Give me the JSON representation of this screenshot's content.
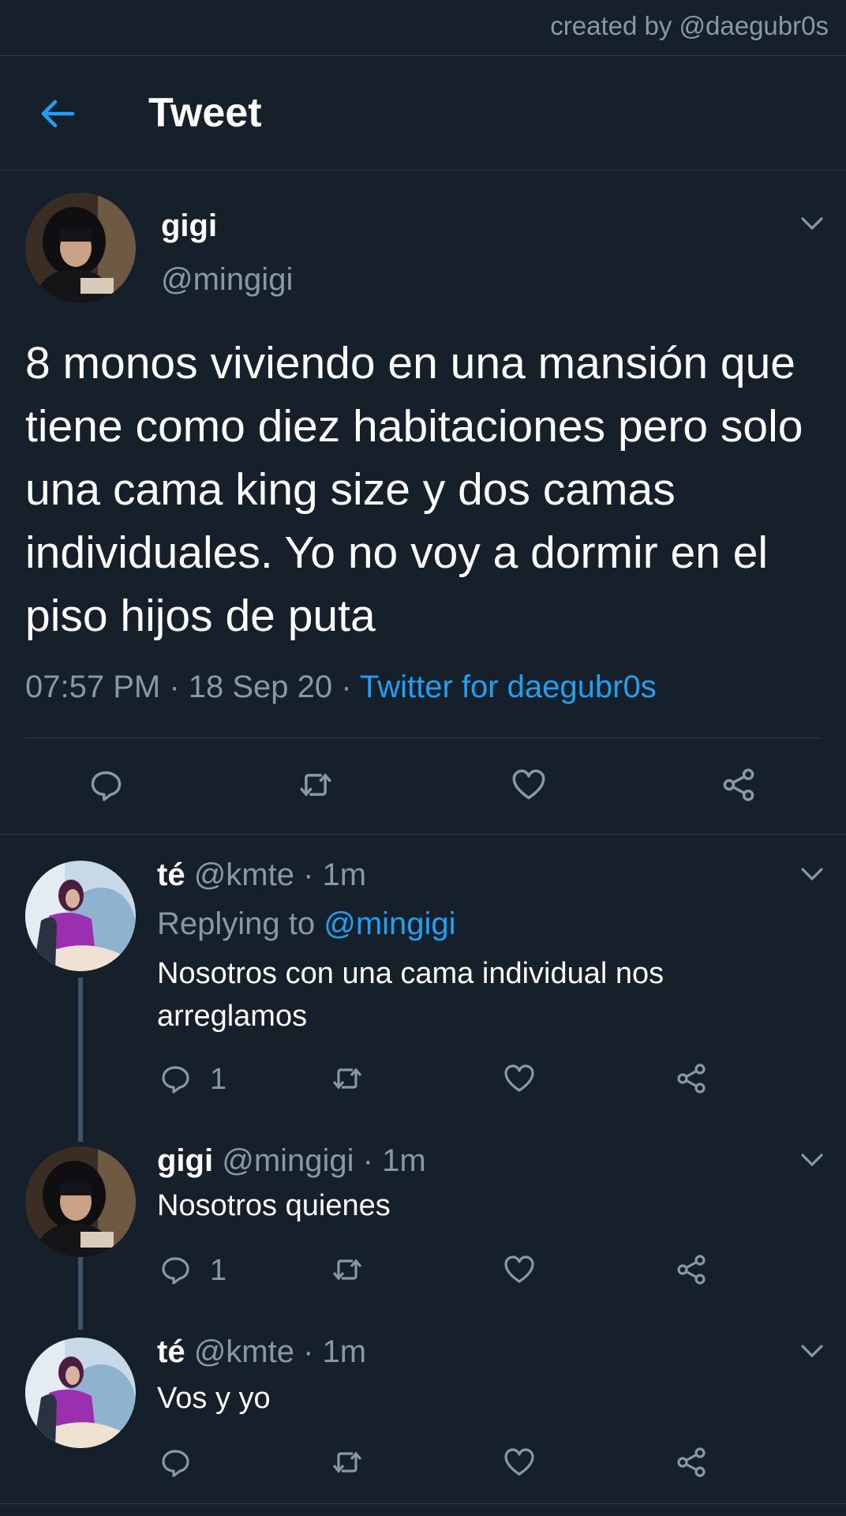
{
  "watermark": "created by @daegubr0s",
  "header": {
    "title": "Tweet"
  },
  "tweet": {
    "name": "gigi",
    "handle": "@mingigi",
    "text": "8 monos viviendo en una mansión que tiene como diez habitaciones pero solo una cama king size y dos camas individuales. Yo no voy a dormir en el piso hijos de puta",
    "time": "07:57 PM · 18 Sep 20 · ",
    "client": "Twitter for daegubr0s"
  },
  "replies": [
    {
      "name": "té",
      "meta": " @kmte · 1m",
      "replying_prefix": "Replying to ",
      "replying_handle": "@mingigi",
      "text": "Nosotros con una cama individual nos arreglamos",
      "reply_count": "1"
    },
    {
      "name": "gigi",
      "meta": " @mingigi · 1m",
      "text": "Nosotros quienes",
      "reply_count": "1"
    },
    {
      "name": "té",
      "meta": " @kmte · 1m",
      "text": "Vos y yo"
    }
  ],
  "colors": {
    "background": "#15202b",
    "accent": "#1da1f2",
    "muted": "#8899a6"
  }
}
